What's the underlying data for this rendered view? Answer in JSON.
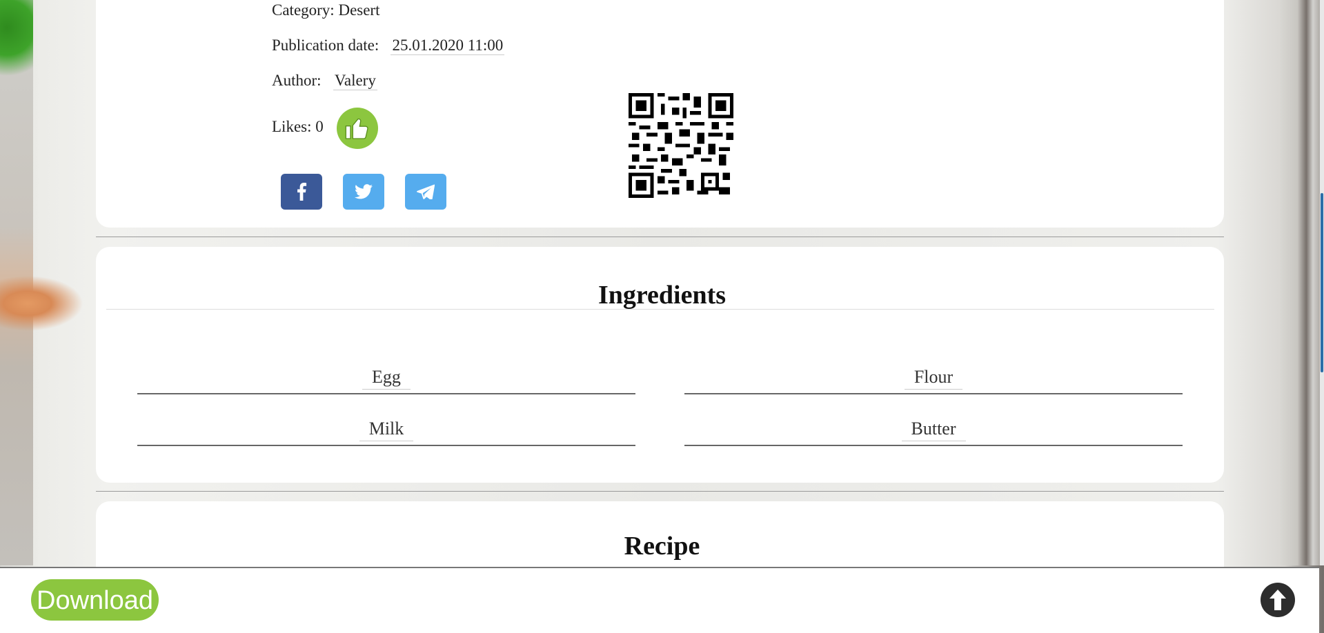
{
  "recipe": {
    "category_label": "Category:",
    "category_value": "Desert",
    "pubdate_label": "Publication date:",
    "pubdate_value": "25.01.2020 11:00",
    "author_label": "Author:",
    "author_value": "Valery",
    "likes_label": "Likes:",
    "likes_value": "0"
  },
  "social": [
    {
      "name": "facebook",
      "color": "#3b5998"
    },
    {
      "name": "twitter",
      "color": "#55acee"
    },
    {
      "name": "telegram",
      "color": "#55acee"
    }
  ],
  "ingredients": {
    "title": "Ingredients",
    "items": [
      "Egg",
      "Flour",
      "Milk",
      "Butter"
    ]
  },
  "recipe_section": {
    "title": "Recipe"
  },
  "footer": {
    "download_label": "Download"
  },
  "colors": {
    "accent_green": "#8cc63f",
    "facebook": "#3b5998",
    "twitter": "#55acee"
  }
}
